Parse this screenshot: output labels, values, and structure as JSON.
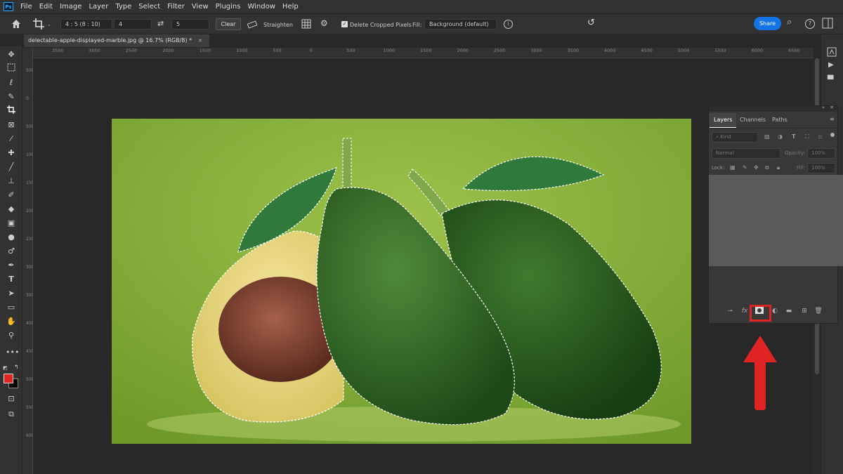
{
  "app": {
    "logo": "Ps"
  },
  "menu": [
    "File",
    "Edit",
    "Image",
    "Layer",
    "Type",
    "Select",
    "Filter",
    "View",
    "Plugins",
    "Window",
    "Help"
  ],
  "options": {
    "ratio": "4 : 5 (8 : 10)",
    "width_value": "4",
    "height_value": "5",
    "clear": "Clear",
    "straighten": "Straighten",
    "delete_cropped": "Delete Cropped Pixels",
    "fill_label": "Fill:",
    "fill_value": "Background (default)",
    "share": "Share"
  },
  "document": {
    "tab_title": "delectable-apple-displayed-marble.jpg @ 16.7% (RGB/8) *",
    "close": "×"
  },
  "ruler": {
    "top_ticks": [
      "3500",
      "3000",
      "2500",
      "2000",
      "1500",
      "1000",
      "500",
      "0",
      "500",
      "1000",
      "1500",
      "2000",
      "2500",
      "3000",
      "3500",
      "4000",
      "4500",
      "5000",
      "5500",
      "6000",
      "6500"
    ],
    "left_ticks": [
      "500",
      "0",
      "500",
      "1000",
      "1500",
      "2000",
      "2500",
      "3000",
      "3500",
      "4000",
      "4500",
      "5000",
      "5500",
      "6000"
    ]
  },
  "layers_panel": {
    "tabs": [
      "Layers",
      "Channels",
      "Paths"
    ],
    "kind_placeholder": "Kind",
    "blend_mode": "Normal",
    "opacity_label": "Opacity:",
    "opacity_value": "100%",
    "lock_label": "Lock:",
    "fill_label": "Fill:",
    "fill_value": "100%"
  },
  "colors": {
    "accent": "#1473e6",
    "highlight": "#e02424",
    "foreground_swatch": "#e02424",
    "background_swatch": "#000000"
  }
}
